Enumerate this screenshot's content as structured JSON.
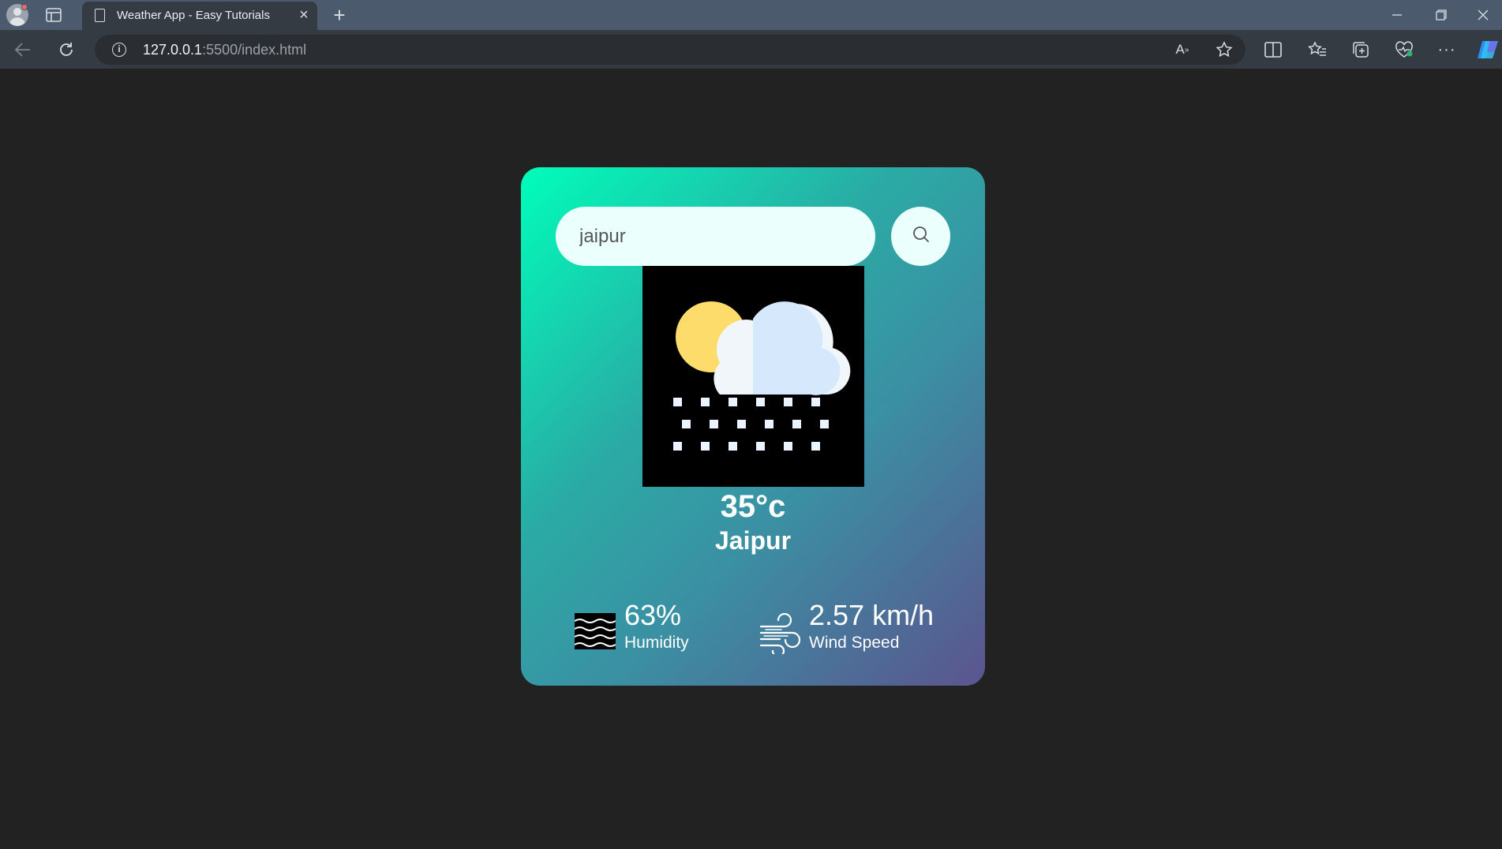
{
  "browser": {
    "tab_title": "Weather App - Easy Tutorials",
    "url_host": "127.0.0.1",
    "url_rest": ":5500/index.html"
  },
  "weather": {
    "search_value": "jaipur",
    "temperature": "35°c",
    "city": "Jaipur",
    "humidity_value": "63%",
    "humidity_label": "Humidity",
    "wind_value": "2.57 km/h",
    "wind_label": "Wind Speed",
    "condition_icon": "snow-icon"
  },
  "colors": {
    "page_bg": "#222222",
    "card_gradient_start": "#00feba",
    "card_gradient_end": "#5b548e",
    "input_bg": "#ebfffc"
  }
}
